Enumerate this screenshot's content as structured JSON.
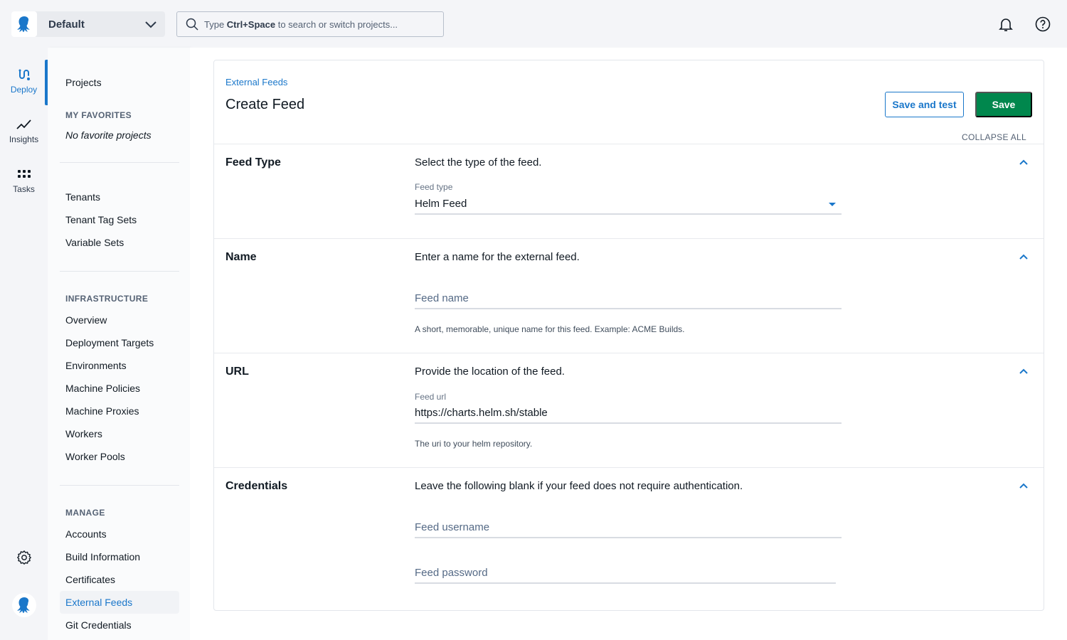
{
  "topbar": {
    "space_name": "Default",
    "search_prefix": "Type ",
    "search_shortcut": "Ctrl+Space",
    "search_suffix": " to search or switch projects...",
    "icons": [
      "octopus-logo-icon",
      "chevron-down-icon",
      "search-icon",
      "bell-icon",
      "help-icon"
    ]
  },
  "rail": {
    "items": [
      {
        "label": "Deploy",
        "icon": "deploy-icon",
        "active": true
      },
      {
        "label": "Insights",
        "icon": "insights-icon",
        "active": false
      },
      {
        "label": "Tasks",
        "icon": "tasks-icon",
        "active": false
      }
    ],
    "bottom_icons": [
      "gear-icon",
      "octopus-avatar-icon"
    ]
  },
  "sidebar": {
    "projects": "Projects",
    "favorites_heading": "MY FAVORITES",
    "favorites_empty": "No favorite projects",
    "group1": [
      "Tenants",
      "Tenant Tag Sets",
      "Variable Sets"
    ],
    "infrastructure_heading": "INFRASTRUCTURE",
    "infrastructure": [
      "Overview",
      "Deployment Targets",
      "Environments",
      "Machine Policies",
      "Machine Proxies",
      "Workers",
      "Worker Pools"
    ],
    "manage_heading": "MANAGE",
    "manage": [
      "Accounts",
      "Build Information",
      "Certificates",
      "External Feeds",
      "Git Credentials"
    ],
    "active_item": "External Feeds"
  },
  "page": {
    "breadcrumb": "External Feeds",
    "title": "Create Feed",
    "save_and_test_label": "Save and test",
    "save_label": "Save",
    "collapse_all_label": "COLLAPSE ALL"
  },
  "sections": {
    "feed_type": {
      "title": "Feed Type",
      "description": "Select the type of the feed.",
      "field_label": "Feed type",
      "value": "Helm Feed"
    },
    "name": {
      "title": "Name",
      "description": "Enter a name for the external feed.",
      "placeholder": "Feed name",
      "help": "A short, memorable, unique name for this feed. Example: ACME Builds."
    },
    "url": {
      "title": "URL",
      "description": "Provide the location of the feed.",
      "field_label": "Feed url",
      "value": "https://charts.helm.sh/stable",
      "help": "The uri to your helm repository."
    },
    "credentials": {
      "title": "Credentials",
      "description": "Leave the following blank if your feed does not require authentication.",
      "username_placeholder": "Feed username",
      "password_placeholder": "Feed password"
    }
  },
  "colors": {
    "accent": "#1a77ca",
    "save": "#00874d",
    "background": "#f4f5f8"
  }
}
